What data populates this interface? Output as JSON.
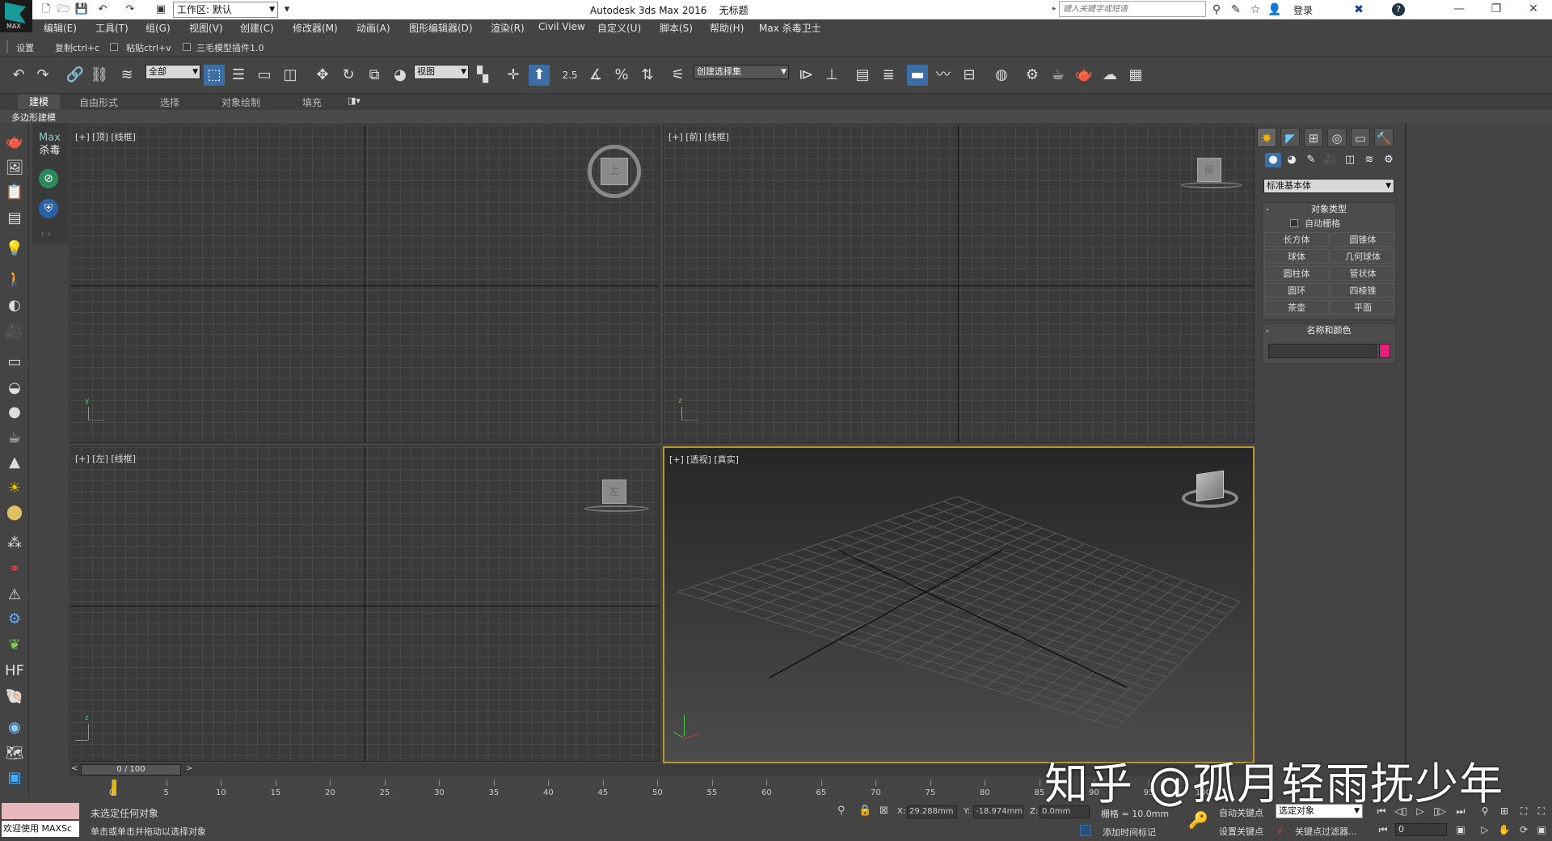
{
  "title_bar": {
    "app_title": "Autodesk 3ds Max 2016",
    "doc_title": "无标题",
    "logo_text": "MAX",
    "workspace": "工作区: 默认",
    "search_placeholder": "键入关键字或短语",
    "login": "登录"
  },
  "menu": [
    "编辑(E)",
    "工具(T)",
    "组(G)",
    "视图(V)",
    "创建(C)",
    "修改器(M)",
    "动画(A)",
    "图形编辑器(D)",
    "渲染(R)",
    "Civil View",
    "自定义(U)",
    "脚本(S)",
    "帮助(H)",
    "Max 杀毒卫士"
  ],
  "toolbar2": {
    "settings": "设置",
    "copy": "复制ctrl+c",
    "paste": "粘贴ctrl+v",
    "hair_plugin": "三毛模型插件1.0"
  },
  "toolbar": {
    "selection_filter": "全部",
    "ref_coord": "视图",
    "snap_value": "2.5",
    "named_selection": "创建选择集"
  },
  "ribbon": {
    "tabs": [
      "建模",
      "自由形式",
      "选择",
      "对象绘制",
      "填充"
    ],
    "sub": "多边形建模"
  },
  "max_kill": {
    "title_line1": "Max",
    "title_line2": "杀毒"
  },
  "viewports": {
    "top": "[+] [顶] [线框]",
    "front": "[+] [前] [线框]",
    "left": "[+] [左] [线框]",
    "persp": "[+] [透视] [真实]",
    "cube_top": "上",
    "cube_front": "前",
    "cube_left": "左"
  },
  "command_panel": {
    "primitive_type": "标准基本体",
    "object_type_title": "对象类型",
    "autogrid": "自动栅格",
    "objects": [
      "长方体",
      "圆锥体",
      "球体",
      "几何球体",
      "圆柱体",
      "管状体",
      "圆环",
      "四棱锥",
      "茶壶",
      "平面"
    ],
    "name_color_title": "名称和颜色",
    "object_color": "#e0207a"
  },
  "timeline": {
    "slider": "0 / 100",
    "ticks": [
      "0",
      "5",
      "10",
      "15",
      "20",
      "25",
      "30",
      "35",
      "40",
      "45",
      "50",
      "55",
      "60",
      "65",
      "70",
      "75",
      "80",
      "85",
      "90",
      "95",
      "100"
    ]
  },
  "status": {
    "maxscript_welcome": "欢迎使用 MAXSc",
    "line1": "未选定任何对象",
    "line2": "单击或单击并拖动以选择对象",
    "x_label": "X:",
    "x": "29.288mm",
    "y_label": "Y:",
    "y": "-18.974mm",
    "z_label": "Z:",
    "z": "0.0mm",
    "grid": "栅格 = 10.0mm",
    "add_time_tag": "添加时间标记",
    "auto_key": "自动关键点",
    "set_key": "设置关键点",
    "selected_object": "选定对象",
    "key_filters": "关键点过滤器...",
    "frame": "0"
  },
  "watermark": "知乎 @孤月轻雨抚少年"
}
